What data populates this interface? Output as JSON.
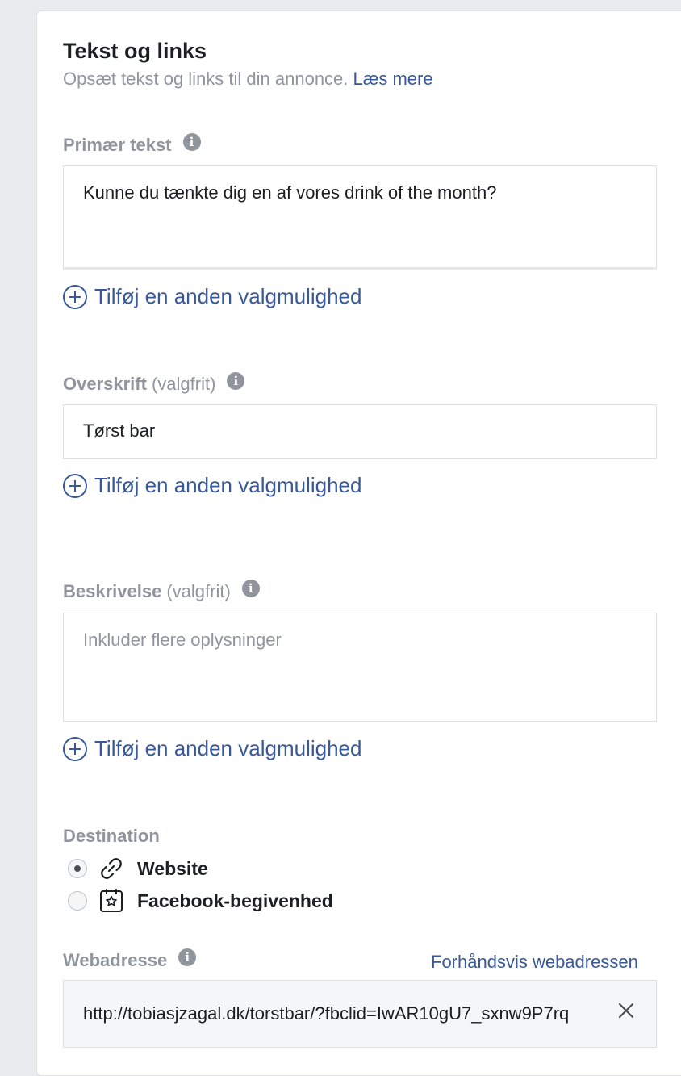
{
  "section": {
    "title": "Tekst og links",
    "subtitle": "Opsæt tekst og links til din annonce.",
    "learn_more": "Læs mere"
  },
  "primary_text": {
    "label": "Primær tekst",
    "value": "Kunne du tænkte dig en af vores drink of the month?",
    "add_option": "Tilføj en anden valgmulighed"
  },
  "headline": {
    "label": "Overskrift",
    "optional": "(valgfrit)",
    "value": "Tørst bar",
    "add_option": "Tilføj en anden valgmulighed"
  },
  "description": {
    "label": "Beskrivelse",
    "optional": "(valgfrit)",
    "placeholder": "Inkluder flere oplysninger",
    "add_option": "Tilføj en anden valgmulighed"
  },
  "destination": {
    "label": "Destination",
    "options": [
      {
        "label": "Website",
        "icon": "link-icon",
        "selected": true
      },
      {
        "label": "Facebook-begivenhed",
        "icon": "event-star-icon",
        "selected": false
      }
    ]
  },
  "web_address": {
    "label": "Webadresse",
    "preview_link": "Forhåndsvis webadressen",
    "value": "http://tobiasjzagal.dk/torstbar/?fbclid=IwAR10gU7_sxnw9P7rq"
  },
  "colors": {
    "link": "#385898",
    "label_gray": "#90949c",
    "text": "#1c1e21"
  }
}
